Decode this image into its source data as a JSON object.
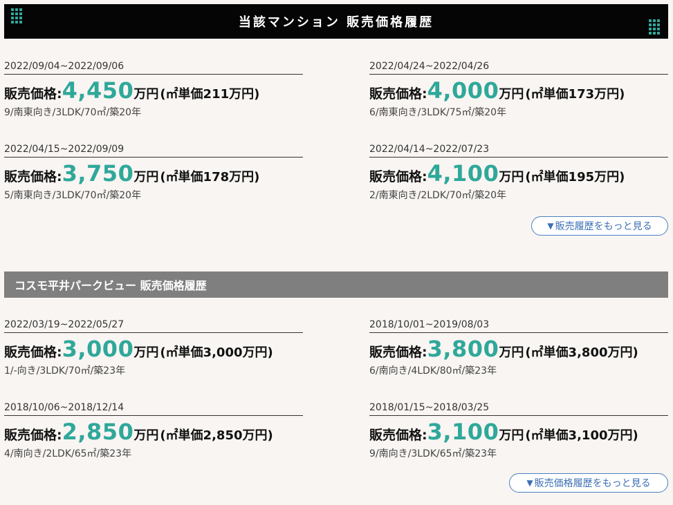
{
  "section1": {
    "title": "当該マンション 販売価格履歴",
    "entries": [
      {
        "date": "2022/09/04~2022/09/06",
        "label": "販売価格:",
        "value": "4,450",
        "unit": "万円",
        "per": "(㎡単価211万円)",
        "detail": "9/南東向き/3LDK/70㎡/築20年"
      },
      {
        "date": "2022/04/24~2022/04/26",
        "label": "販売価格:",
        "value": "4,000",
        "unit": "万円",
        "per": "(㎡単価173万円)",
        "detail": "6/南東向き/3LDK/75㎡/築20年"
      },
      {
        "date": "2022/04/15~2022/09/09",
        "label": "販売価格:",
        "value": "3,750",
        "unit": "万円",
        "per": "(㎡単価178万円)",
        "detail": "5/南東向き/3LDK/70㎡/築20年"
      },
      {
        "date": "2022/04/14~2022/07/23",
        "label": "販売価格:",
        "value": "4,100",
        "unit": "万円",
        "per": "(㎡単価195万円)",
        "detail": "2/南東向き/2LDK/70㎡/築20年"
      }
    ],
    "more_label": "販売履歴をもっと見る"
  },
  "section2": {
    "title": "コスモ平井パークビュー 販売価格履歴",
    "entries": [
      {
        "date": "2022/03/19~2022/05/27",
        "label": "販売価格:",
        "value": "3,000",
        "unit": "万円",
        "per": "(㎡単価3,000万円)",
        "detail": "1/-向き/3LDK/70㎡/築23年"
      },
      {
        "date": "2018/10/01~2019/08/03",
        "label": "販売価格:",
        "value": "3,800",
        "unit": "万円",
        "per": "(㎡単価3,800万円)",
        "detail": "6/南向き/4LDK/80㎡/築23年"
      },
      {
        "date": "2018/10/06~2018/12/14",
        "label": "販売価格:",
        "value": "2,850",
        "unit": "万円",
        "per": "(㎡単価2,850万円)",
        "detail": "4/南向き/2LDK/65㎡/築23年"
      },
      {
        "date": "2018/01/15~2018/03/25",
        "label": "販売価格:",
        "value": "3,100",
        "unit": "万円",
        "per": "(㎡単価3,100万円)",
        "detail": "9/南向き/3LDK/65㎡/築23年"
      }
    ],
    "more_label": "販売価格履歴をもっと見る"
  },
  "colors": {
    "accent": "#2fa89a",
    "link": "#3b6fb5",
    "header_dark": "#050505",
    "header_gray": "#7f7f7f"
  },
  "icons": {
    "more": "triangle-down-icon",
    "corner": "grid-dots-icon"
  }
}
